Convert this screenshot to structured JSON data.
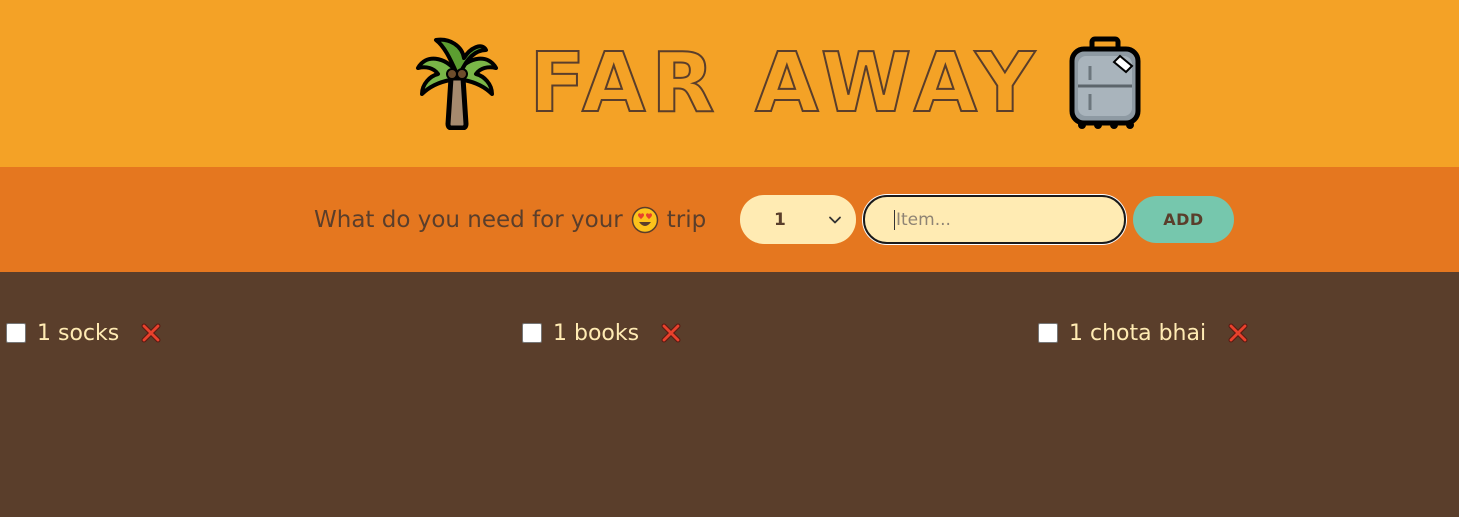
{
  "header": {
    "title": "FAR AWAY",
    "left_icon": "palm-tree-icon",
    "right_icon": "luggage-icon"
  },
  "form": {
    "prompt_before": "What do you need for your",
    "prompt_emoji": "heart-eyes-emoji-icon",
    "prompt_after": "trip",
    "quantity_selected": "1",
    "item_placeholder": "Item...",
    "item_value": "",
    "add_label": "ADD"
  },
  "items": [
    {
      "quantity": 1,
      "description": "1 socks",
      "packed": false
    },
    {
      "quantity": 1,
      "description": "1 books",
      "packed": false
    },
    {
      "quantity": 1,
      "description": "1 chota bhai",
      "packed": false
    }
  ],
  "colors": {
    "header_bg": "#f4a226",
    "form_bg": "#e5771f",
    "list_bg": "#5a3e2b",
    "text_light": "#ffebb3",
    "button_bg": "#76c7ad",
    "delete_red": "#e8412c"
  }
}
